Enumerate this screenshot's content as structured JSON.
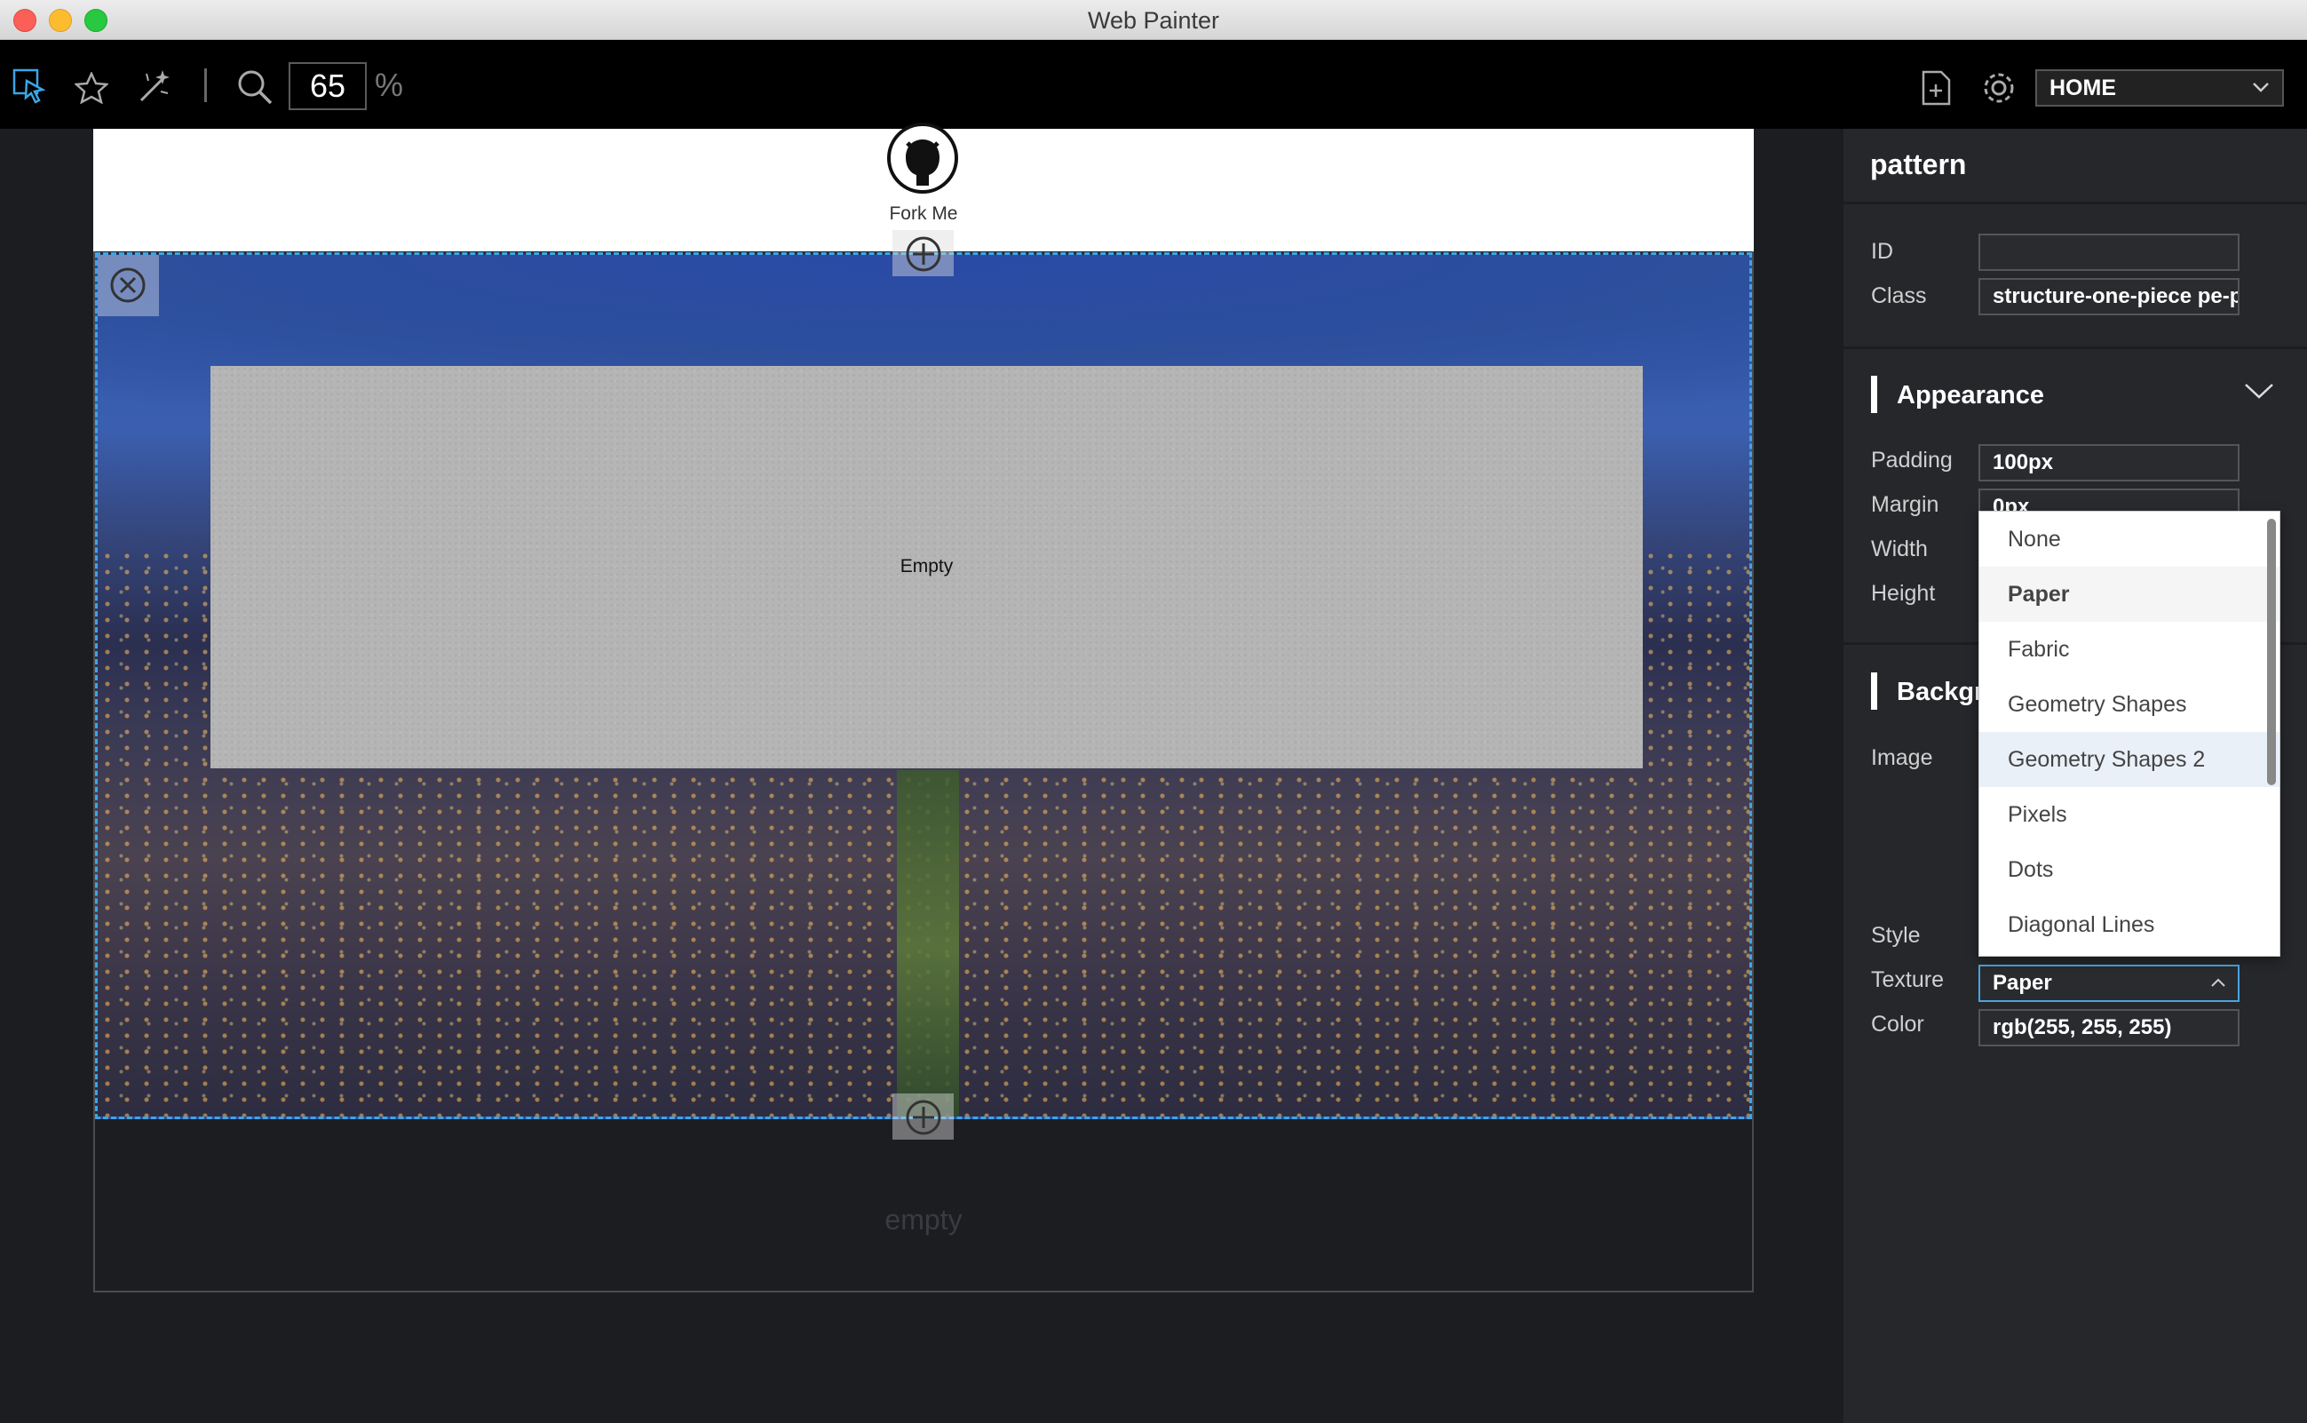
{
  "window": {
    "title": "Web Painter"
  },
  "toolbar": {
    "zoom_value": "65",
    "zoom_unit": "%",
    "page_select": "HOME"
  },
  "canvas": {
    "fork_label": "Fork Me",
    "pattern_empty_label": "Empty",
    "footer_empty_label": "empty"
  },
  "panel": {
    "title": "pattern",
    "id_label": "ID",
    "id_value": "",
    "class_label": "Class",
    "class_value": "structure-one-piece pe-patte",
    "appearance": {
      "heading": "Appearance",
      "padding_label": "Padding",
      "padding_value": "100px",
      "margin_label": "Margin",
      "margin_value": "0px",
      "width_label": "Width",
      "height_label": "Height"
    },
    "background": {
      "heading": "Backgro",
      "image_label": "Image",
      "style_label": "Style",
      "texture_label": "Texture",
      "texture_value": "Paper",
      "color_label": "Color",
      "color_value": "rgb(255, 255, 255)"
    }
  },
  "texture_dropdown": {
    "options": [
      "None",
      "Paper",
      "Fabric",
      "Geometry Shapes",
      "Geometry Shapes 2",
      "Pixels",
      "Dots",
      "Diagonal Lines"
    ],
    "selected": "Paper",
    "hovered": "Geometry Shapes 2"
  },
  "colors": {
    "selection_border": "#3ba6e8",
    "panel_bg": "#26272b",
    "toolbar_bg": "#000000"
  }
}
